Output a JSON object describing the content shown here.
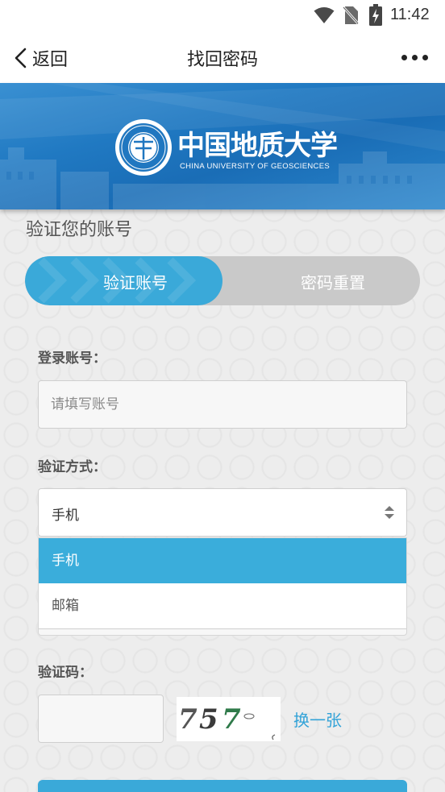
{
  "status_bar": {
    "time": "11:42",
    "icons": [
      "wifi-icon",
      "no-sim-icon",
      "battery-charging-icon"
    ]
  },
  "nav": {
    "back_label": "返回",
    "title": "找回密码",
    "icons": [
      "chevron-left-icon",
      "more-icon"
    ]
  },
  "banner": {
    "logo_text_cn": "中国地质大学",
    "logo_text_en": "CHINA UNIVERSITY OF GEOSCIENCES"
  },
  "page": {
    "heading": "验证您的账号"
  },
  "steps": [
    {
      "label": "验证账号",
      "active": true
    },
    {
      "label": "密码重置",
      "active": false
    }
  ],
  "form": {
    "account": {
      "label": "登录账号：",
      "placeholder": "请填写账号",
      "value": ""
    },
    "method": {
      "label": "验证方式：",
      "selected": "手机",
      "options": [
        "手机",
        "邮箱"
      ],
      "highlighted_option": "手机",
      "dropdown_open": true
    },
    "captcha": {
      "label": "验证码：",
      "value": "",
      "image_chars": [
        "7",
        "5",
        "7"
      ],
      "refresh_label": "换一张"
    }
  },
  "colors": {
    "accent": "#3aa9d9",
    "inactive_step": "#c9c9c9",
    "banner_blue": "#1f74bd",
    "link": "#33a3d8"
  }
}
